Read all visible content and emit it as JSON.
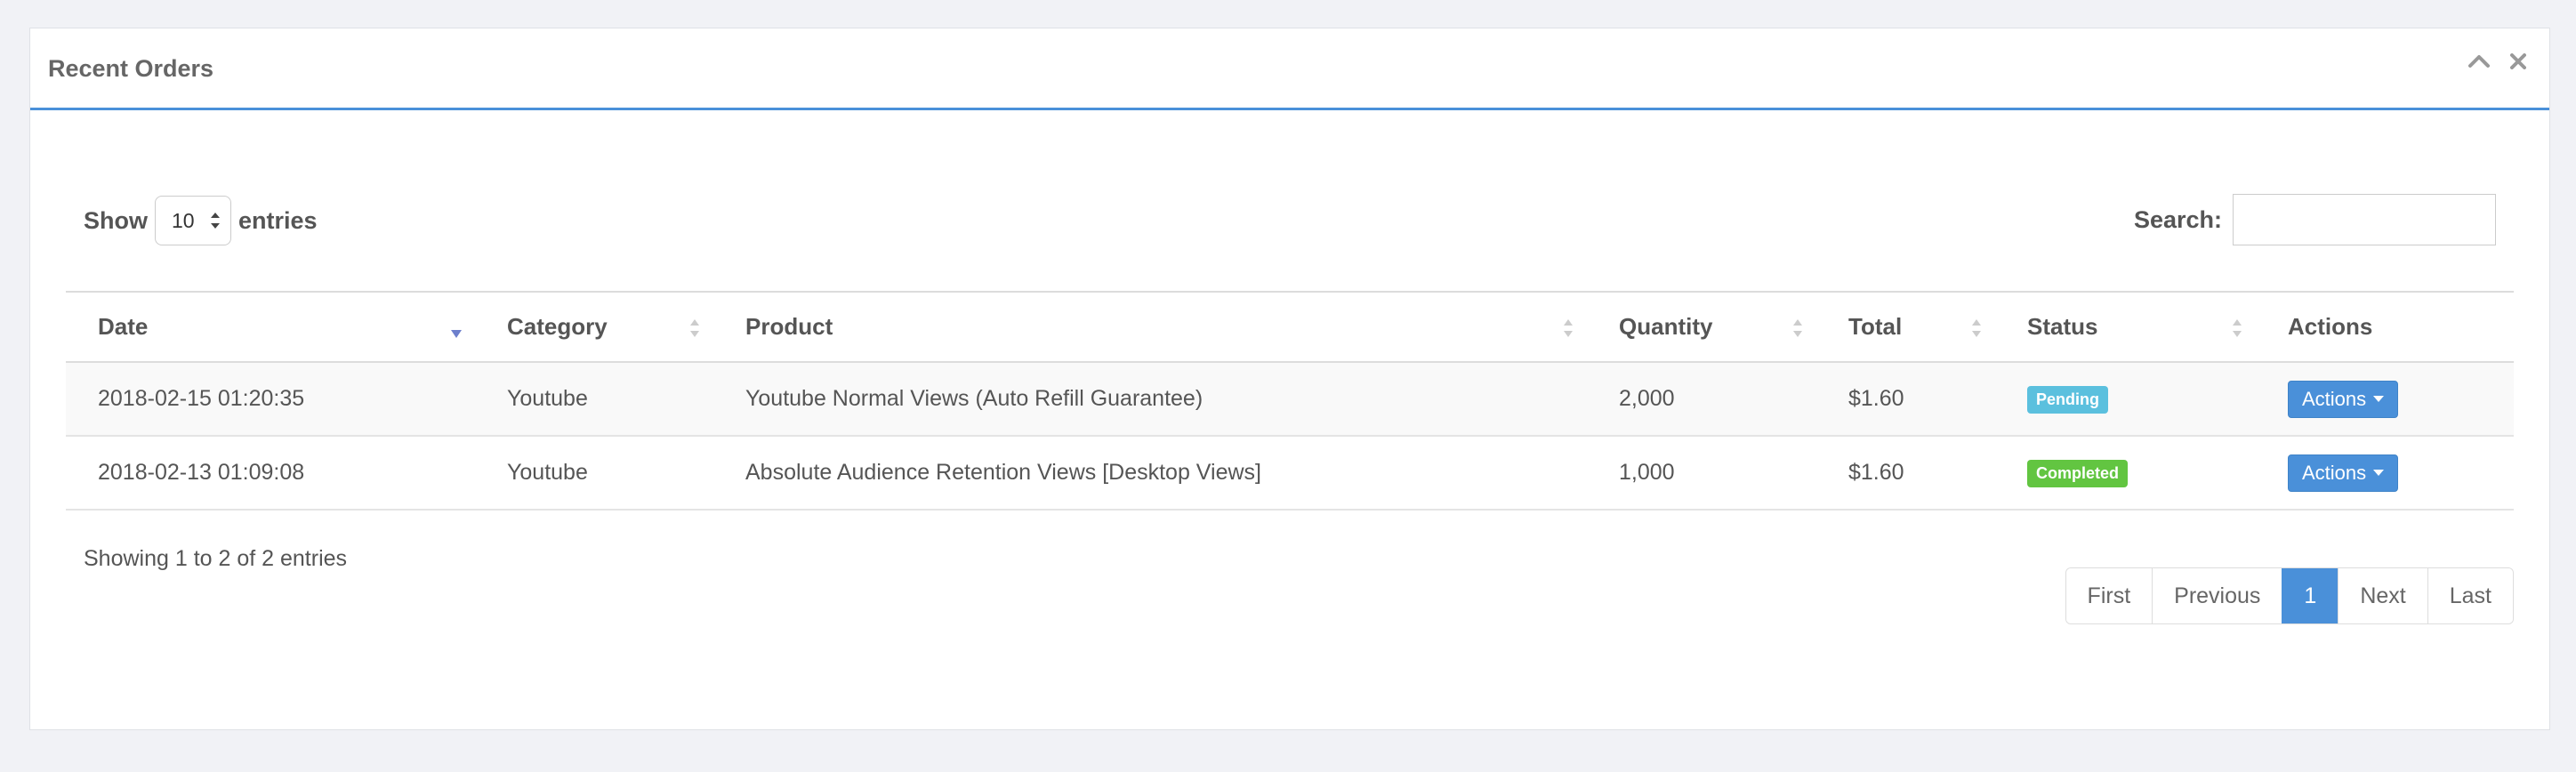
{
  "panel": {
    "title": "Recent Orders",
    "tools": {
      "collapse_icon": "chevron-up-icon",
      "close_icon": "close-icon"
    }
  },
  "length_control": {
    "show_label": "Show",
    "selected": "10",
    "entries_label": "entries"
  },
  "search": {
    "label": "Search:",
    "value": "",
    "placeholder": ""
  },
  "table": {
    "columns": [
      "Date",
      "Category",
      "Product",
      "Quantity",
      "Total",
      "Status",
      "Actions"
    ],
    "rows": [
      {
        "date": "2018-02-15 01:20:35",
        "category": "Youtube",
        "product": "Youtube Normal Views (Auto Refill Guarantee)",
        "quantity": "2,000",
        "total": "$1.60",
        "status": "Pending",
        "action": "Actions"
      },
      {
        "date": "2018-02-13 01:09:08",
        "category": "Youtube",
        "product": "Absolute Audience Retention Views [Desktop Views]",
        "quantity": "1,000",
        "total": "$1.60",
        "status": "Completed",
        "action": "Actions"
      }
    ]
  },
  "info": "Showing 1 to 2 of 2 entries",
  "pagination": {
    "first": "First",
    "previous": "Previous",
    "current": "1",
    "next": "Next",
    "last": "Last"
  },
  "colors": {
    "accent": "#4a90d9",
    "pending": "#5bc0de",
    "completed": "#62c541",
    "background": "#f1f2f6"
  }
}
